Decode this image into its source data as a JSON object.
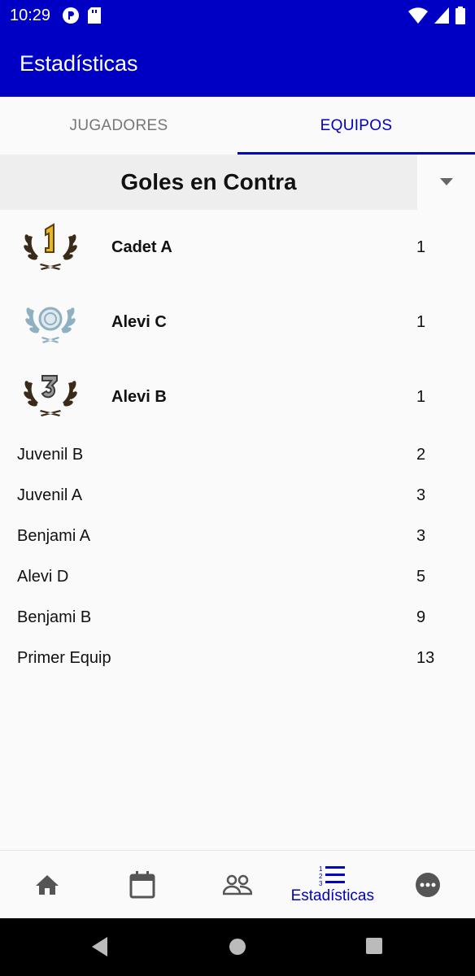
{
  "status_bar": {
    "time": "10:29"
  },
  "app_bar": {
    "title": "Estadísticas"
  },
  "tabs": [
    {
      "label": "JUGADORES",
      "active": false
    },
    {
      "label": "EQUIPOS",
      "active": true
    }
  ],
  "selector": {
    "value": "Goles en Contra"
  },
  "podium": [
    {
      "rank": "1",
      "team": "Cadet A",
      "value": "1"
    },
    {
      "rank": "2",
      "team": "Alevi C",
      "value": "1"
    },
    {
      "rank": "3",
      "team": "Alevi B",
      "value": "1"
    }
  ],
  "list": [
    {
      "team": "Juvenil B",
      "value": "2"
    },
    {
      "team": "Juvenil A",
      "value": "3"
    },
    {
      "team": "Benjami A",
      "value": "3"
    },
    {
      "team": "Alevi D",
      "value": "5"
    },
    {
      "team": "Benjami B",
      "value": "9"
    },
    {
      "team": "Primer Equip",
      "value": "13"
    }
  ],
  "bottom_nav": {
    "items": [
      {
        "icon": "home-icon"
      },
      {
        "icon": "calendar-icon"
      },
      {
        "icon": "people-icon"
      },
      {
        "icon": "ranking-list-icon",
        "label": "Estadísticas",
        "active": true
      },
      {
        "icon": "more-icon"
      }
    ]
  },
  "colors": {
    "primary": "#0000c4",
    "gold": "#e8b820",
    "silver": "#8fb0c0",
    "laurel": "#3a2a18"
  }
}
